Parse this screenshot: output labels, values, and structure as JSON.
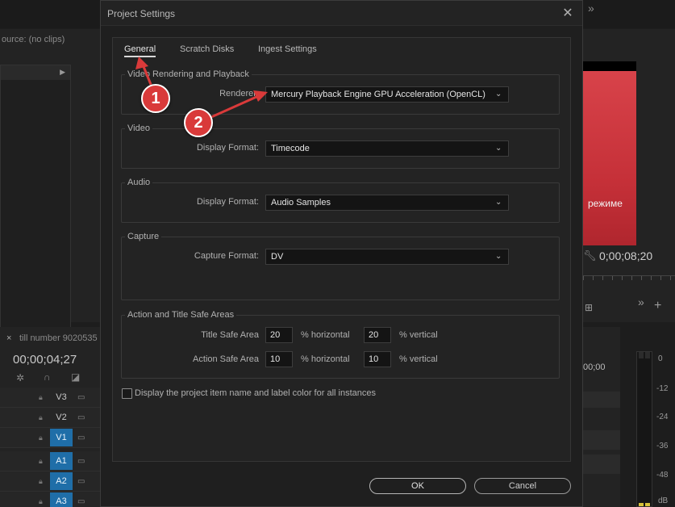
{
  "background": {
    "source_label": "ource: (no clips)",
    "sequence_tab": "till number 9020535",
    "timecode_left": "00;00;04;27",
    "timecode_right": "0;00;08;20",
    "timeline_marker": "00;00",
    "preview_text": "режиме",
    "tracks": [
      {
        "label": "V3",
        "active": false
      },
      {
        "label": "V2",
        "active": false
      },
      {
        "label": "V1",
        "active": true
      },
      {
        "label": "A1",
        "active": true
      },
      {
        "label": "A2",
        "active": true
      },
      {
        "label": "A3",
        "active": true
      }
    ],
    "meter_scale": [
      "0",
      "-12",
      "-24",
      "-36",
      "-48",
      "dB"
    ],
    "colors": {
      "preview_red": "#c8323c",
      "track_active": "#1f6ea8"
    }
  },
  "dialog": {
    "title": "Project Settings",
    "tabs": [
      {
        "label": "General",
        "active": true
      },
      {
        "label": "Scratch Disks",
        "active": false
      },
      {
        "label": "Ingest Settings",
        "active": false
      }
    ],
    "sections": {
      "video_rendering": {
        "label": "Video Rendering and Playback",
        "renderer_label": "Renderer:",
        "renderer_value": "Mercury Playback Engine GPU Acceleration (OpenCL)"
      },
      "video": {
        "label": "Video",
        "display_format_label": "Display Format:",
        "display_format_value": "Timecode"
      },
      "audio": {
        "label": "Audio",
        "display_format_label": "Display Format:",
        "display_format_value": "Audio Samples"
      },
      "capture": {
        "label": "Capture",
        "capture_format_label": "Capture Format:",
        "capture_format_value": "DV"
      },
      "safe_areas": {
        "label": "Action and Title Safe Areas",
        "title_safe_label": "Title Safe Area",
        "title_safe_h": "20",
        "title_safe_v": "20",
        "action_safe_label": "Action Safe Area",
        "action_safe_h": "10",
        "action_safe_v": "10",
        "horizontal_unit": "% horizontal",
        "vertical_unit": "% vertical"
      }
    },
    "checkbox_label": "Display the project item name and label color for all instances",
    "checkbox_checked": false,
    "ok_label": "OK",
    "cancel_label": "Cancel"
  },
  "annotations": {
    "badge_1": "1",
    "badge_2": "2",
    "color": "#d93a3a"
  }
}
